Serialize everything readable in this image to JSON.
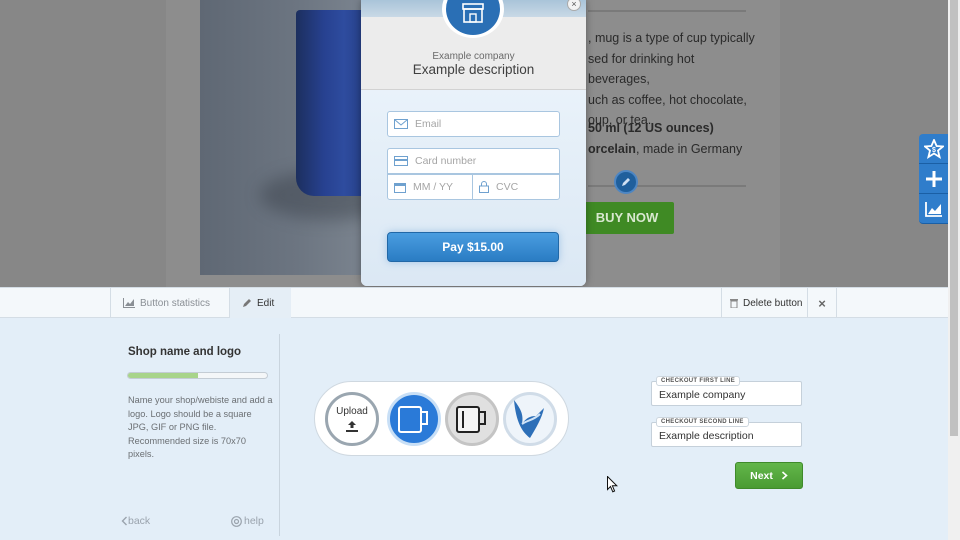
{
  "product": {
    "description_lines": [
      ", mug is a type of cup typically",
      "sed for drinking hot beverages,",
      "uch as coffee, hot chocolate,",
      "oup, or tea."
    ],
    "volume": "50 ml (12 US ounces)",
    "material_bold": "orcelain",
    "material_rest": ", made in Germany",
    "buy_label": "BUY NOW"
  },
  "modal": {
    "company": "Example company",
    "description": "Example description",
    "email_placeholder": "Email",
    "card_placeholder": "Card number",
    "expiry_placeholder": "MM / YY",
    "cvc_placeholder": "CVC",
    "pay_label": "Pay $15.00",
    "close_glyph": "×"
  },
  "side_toolbar": {
    "icons": [
      "star-dollar-icon",
      "plus-icon",
      "chart-icon"
    ]
  },
  "tabs": {
    "statistics": "Button statistics",
    "edit": "Edit",
    "delete": "Delete button",
    "close_glyph": "×"
  },
  "editor": {
    "step_title": "Shop name and logo",
    "progress_fraction": 0.5,
    "help_text": "Name your shop/webiste and add a logo. Logo should be a square JPG, GIF or PNG file. Recommended size is 70x70 pixels.",
    "back_label": "back",
    "help_label": "help",
    "upload_label": "Upload",
    "first_line_label": "CHECKOUT FIRST LINE",
    "first_line_value": "Example company",
    "second_line_label": "CHECKOUT SECOND LINE",
    "second_line_value": "Example description",
    "next_label": "Next"
  },
  "colors": {
    "accent": "#2f7dcb",
    "buy": "#3f8a24",
    "next": "#4a9b33"
  }
}
